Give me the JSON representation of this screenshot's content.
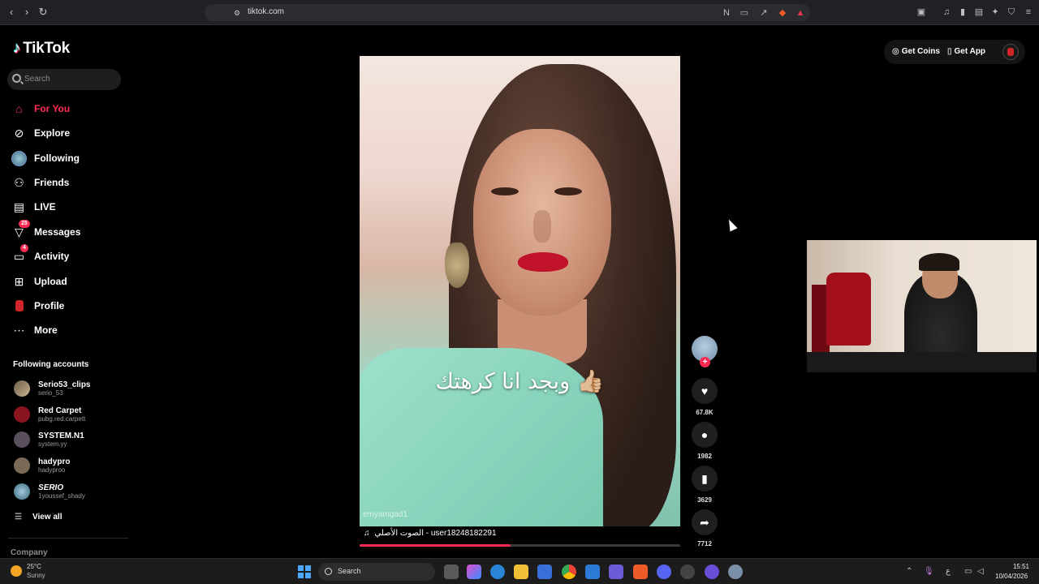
{
  "browser": {
    "url": "tiktok.com",
    "back_icon": "chevron-left-icon",
    "forward_icon": "chevron-right-icon",
    "reload_icon": "reload-icon"
  },
  "tiktok": {
    "logo": "TikTok",
    "search_placeholder": "Search",
    "menu": [
      {
        "label": "For You",
        "icon": "home-icon",
        "active": true
      },
      {
        "label": "Explore",
        "icon": "compass-icon"
      },
      {
        "label": "Following",
        "icon": "following-avatar"
      },
      {
        "label": "Friends",
        "icon": "friends-icon"
      },
      {
        "label": "LIVE",
        "icon": "live-icon"
      },
      {
        "label": "Messages",
        "icon": "messages-icon",
        "badge": "25"
      },
      {
        "label": "Activity",
        "icon": "activity-icon",
        "badge": "4"
      },
      {
        "label": "Upload",
        "icon": "upload-icon"
      },
      {
        "label": "Profile",
        "icon": "profile-icon"
      },
      {
        "label": "More",
        "icon": "more-icon"
      }
    ],
    "following_title": "Following accounts",
    "following_accounts": [
      {
        "name": "Serio53_clips",
        "handle": "serio_53"
      },
      {
        "name": "Red Carpet",
        "handle": "pubg.red.carpett"
      },
      {
        "name": "SYSTEM.N1",
        "handle": "system.yy"
      },
      {
        "name": "hadypro",
        "handle": "hadyproo"
      },
      {
        "name": "SERIO",
        "handle": "1youssef_shady"
      }
    ],
    "view_all": "View all",
    "company": "Company",
    "get_coins": "Get Coins",
    "get_app": "Get App"
  },
  "video": {
    "caption": "وبجد انا كرهتك 👍🏼",
    "watermark": "emyamgad1",
    "music": "الصوت الأصلي - user18248182291",
    "progress_percent": 47,
    "likes": "67.8K",
    "comments": "1982",
    "saves": "3629",
    "shares": "7712"
  },
  "taskbar": {
    "temperature": "25°C",
    "condition": "Sunny",
    "search": "Search",
    "time": "15:51",
    "date": "10/04/2026",
    "language": "ع"
  },
  "colors": {
    "accent": "#fe2c55",
    "background": "#000000"
  }
}
